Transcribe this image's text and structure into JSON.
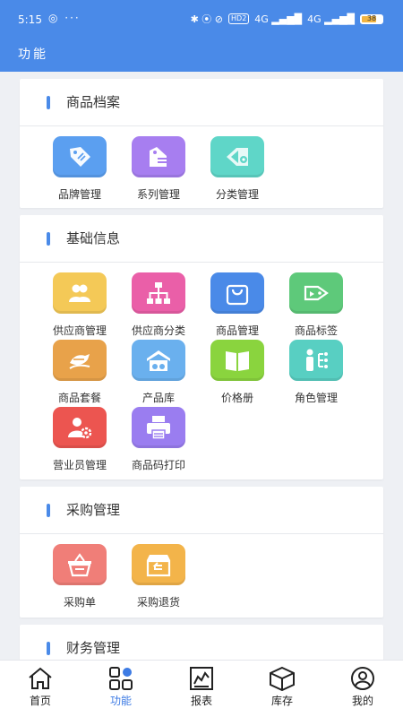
{
  "status": {
    "time": "5:15",
    "left_icons": "◎ ···",
    "right_icons": "✱ ⦿ ⊘",
    "hd": "HD2",
    "signal1": "4G ▂▄▆█",
    "signal2": "4G ▂▄▆█",
    "battery": "38"
  },
  "header": {
    "title": "功能"
  },
  "sections": [
    {
      "title": "商品档案",
      "items": [
        {
          "label": "品牌管理",
          "icon": "tag-icon",
          "color": "#5b9ff0"
        },
        {
          "label": "系列管理",
          "icon": "series-icon",
          "color": "#a77ef0"
        },
        {
          "label": "分类管理",
          "icon": "category-icon",
          "color": "#5fd6c8"
        }
      ]
    },
    {
      "title": "基础信息",
      "items": [
        {
          "label": "供应商管理",
          "icon": "users-icon",
          "color": "#f4c957"
        },
        {
          "label": "供应商分类",
          "icon": "hierarchy-icon",
          "color": "#ea5fa8"
        },
        {
          "label": "商品管理",
          "icon": "bag-icon",
          "color": "#4a8ae8"
        },
        {
          "label": "商品标签",
          "icon": "label-icon",
          "color": "#5ec97a"
        },
        {
          "label": "商品套餐",
          "icon": "package-icon",
          "color": "#e8a24a"
        },
        {
          "label": "产品库",
          "icon": "warehouse-icon",
          "color": "#6ab0ee"
        },
        {
          "label": "价格册",
          "icon": "book-icon",
          "color": "#8ad43e"
        },
        {
          "label": "角色管理",
          "icon": "role-icon",
          "color": "#58cfc2"
        },
        {
          "label": "营业员管理",
          "icon": "user-gear-icon",
          "color": "#ec5550"
        },
        {
          "label": "商品码打印",
          "icon": "printer-icon",
          "color": "#9a7df0"
        }
      ]
    },
    {
      "title": "采购管理",
      "items": [
        {
          "label": "采购单",
          "icon": "basket-icon",
          "color": "#f07e78"
        },
        {
          "label": "采购退货",
          "icon": "return-box-icon",
          "color": "#f3b44a"
        }
      ]
    },
    {
      "title": "财务管理",
      "items": []
    }
  ],
  "tabs": [
    {
      "label": "首页",
      "icon": "home-icon",
      "active": false
    },
    {
      "label": "功能",
      "icon": "grid-icon",
      "active": true
    },
    {
      "label": "报表",
      "icon": "report-icon",
      "active": false
    },
    {
      "label": "库存",
      "icon": "box-icon",
      "active": false
    },
    {
      "label": "我的",
      "icon": "profile-icon",
      "active": false
    }
  ],
  "colors": {
    "accent": "#4a8ae8",
    "tab_active": "#3d7be4"
  }
}
